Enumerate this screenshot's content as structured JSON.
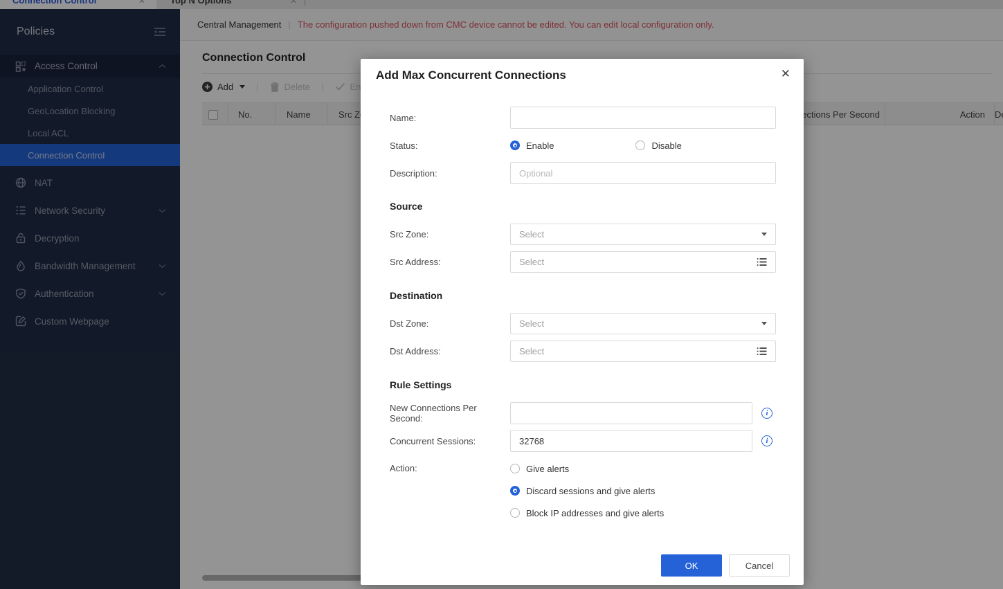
{
  "tabs": [
    {
      "label": "Connection Control",
      "active": true,
      "close": "✕"
    },
    {
      "label": "Top N Options",
      "active": false,
      "close": "✕"
    }
  ],
  "sidebar": {
    "title": "Policies",
    "items": [
      {
        "label": "Access Control",
        "icon": "access-control-icon",
        "expanded": true
      },
      {
        "label": "Application Control"
      },
      {
        "label": "GeoLocation Blocking"
      },
      {
        "label": "Local ACL"
      },
      {
        "label": "Connection Control",
        "selected": true
      },
      {
        "label": "NAT",
        "icon": "globe-icon"
      },
      {
        "label": "Network Security",
        "icon": "list-icon",
        "collapsed": true
      },
      {
        "label": "Decryption",
        "icon": "lock-icon"
      },
      {
        "label": "Bandwidth Management",
        "icon": "droplet-icon",
        "collapsed": true
      },
      {
        "label": "Authentication",
        "icon": "shield-check-icon",
        "collapsed": true
      },
      {
        "label": "Custom Webpage",
        "icon": "edit-icon"
      }
    ]
  },
  "breadcrumb": {
    "left": "Central Management",
    "separator": "|",
    "warning": "The configuration pushed down from CMC device cannot be edited. You can edit local configuration only."
  },
  "page": {
    "title": "Connection Control"
  },
  "toolbar": {
    "add_label": "Add",
    "delete_label": "Delete",
    "enable_label": "Enable"
  },
  "table": {
    "columns": [
      "No.",
      "Name",
      "Src Zone",
      "New Connections Per Second",
      "Action",
      "Description"
    ]
  },
  "modal": {
    "title": "Add Max Concurrent Connections",
    "close": "✕",
    "name_label": "Name:",
    "status_label": "Status:",
    "status_options": [
      "Enable",
      "Disable"
    ],
    "status_selected": "Enable",
    "description_label": "Description:",
    "description_placeholder": "Optional",
    "source_section": "Source",
    "src_zone_label": "Src Zone:",
    "src_address_label": "Src Address:",
    "destination_section": "Destination",
    "dst_zone_label": "Dst Zone:",
    "dst_address_label": "Dst Address:",
    "select_placeholder": "Select",
    "rule_section": "Rule Settings",
    "ncps_label": "New Connections Per Second:",
    "ncps_value": "",
    "concurrent_label": "Concurrent Sessions:",
    "concurrent_value": "32768",
    "action_label": "Action:",
    "action_options": [
      "Give alerts",
      "Discard sessions and give alerts",
      "Block IP addresses and give alerts"
    ],
    "action_selected": "Discard sessions and give alerts",
    "ok_label": "OK",
    "cancel_label": "Cancel"
  },
  "colors": {
    "accent_blue": "#2562d8",
    "sidebar_bg": "#202c45",
    "sidebar_selected": "#2562d8",
    "warning_red": "#d9515d",
    "table_header_bg": "#f3f3f3"
  }
}
